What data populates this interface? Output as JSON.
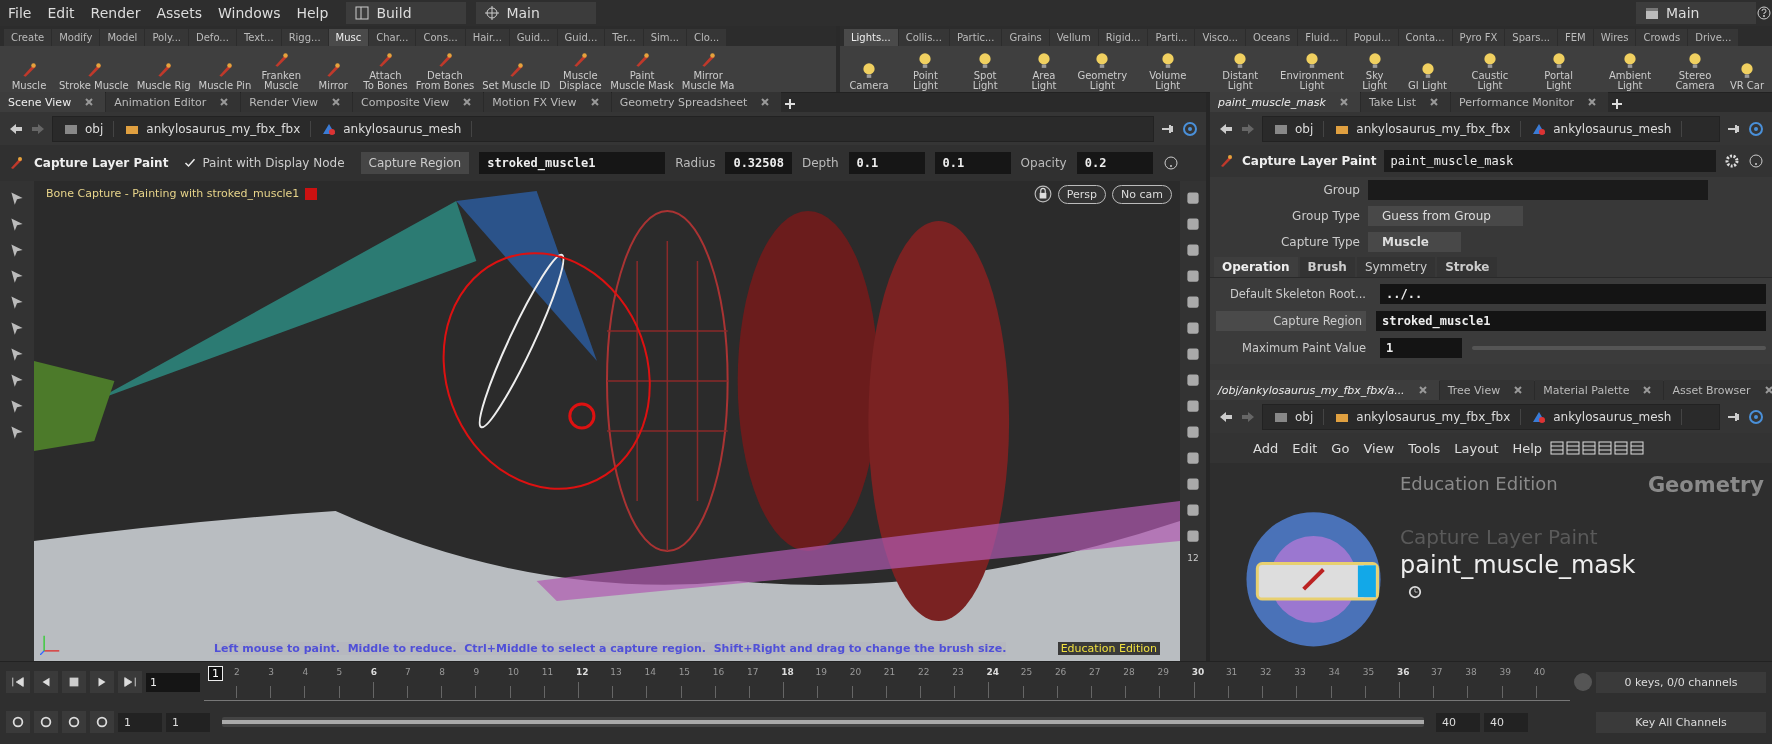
{
  "menu": [
    "File",
    "Edit",
    "Render",
    "Assets",
    "Windows",
    "Help"
  ],
  "desktop": {
    "label": "Build"
  },
  "context": {
    "label": "Main"
  },
  "right_context": {
    "label": "Main"
  },
  "shelf_left": {
    "tabs": [
      {
        "label": "Create",
        "selected": false
      },
      {
        "label": "Modify",
        "selected": false
      },
      {
        "label": "Model",
        "selected": false
      },
      {
        "label": "Poly...",
        "selected": false
      },
      {
        "label": "Defo...",
        "selected": false
      },
      {
        "label": "Text...",
        "selected": false
      },
      {
        "label": "Rigg...",
        "selected": false
      },
      {
        "label": "Musc",
        "selected": true
      },
      {
        "label": "Char...",
        "selected": false
      },
      {
        "label": "Cons...",
        "selected": false
      },
      {
        "label": "Hair...",
        "selected": false
      },
      {
        "label": "Guid...",
        "selected": false
      },
      {
        "label": "Guid...",
        "selected": false
      },
      {
        "label": "Ter...",
        "selected": false
      },
      {
        "label": "Sim...",
        "selected": false
      },
      {
        "label": "Clo...",
        "selected": false
      }
    ],
    "tools": [
      "Muscle",
      "Stroke Muscle",
      "Muscle Rig",
      "Muscle Pin",
      "Franken\nMuscle",
      "Mirror",
      "Attach\nTo Bones",
      "Detach\nFrom Bones",
      "Set Muscle ID",
      "Muscle\nDisplace",
      "Paint\nMuscle Mask",
      "Mirror\nMuscle Ma"
    ]
  },
  "shelf_right": {
    "tabs": [
      {
        "label": "Lights...",
        "selected": true
      },
      {
        "label": "Collis...",
        "selected": false
      },
      {
        "label": "Partic...",
        "selected": false
      },
      {
        "label": "Grains",
        "selected": false
      },
      {
        "label": "Vellum",
        "selected": false
      },
      {
        "label": "Rigid...",
        "selected": false
      },
      {
        "label": "Parti...",
        "selected": false
      },
      {
        "label": "Visco...",
        "selected": false
      },
      {
        "label": "Oceans",
        "selected": false
      },
      {
        "label": "Fluid...",
        "selected": false
      },
      {
        "label": "Popul...",
        "selected": false
      },
      {
        "label": "Conta...",
        "selected": false
      },
      {
        "label": "Pyro FX",
        "selected": false
      },
      {
        "label": "Spars...",
        "selected": false
      },
      {
        "label": "FEM",
        "selected": false
      },
      {
        "label": "Wires",
        "selected": false
      },
      {
        "label": "Crowds",
        "selected": false
      },
      {
        "label": "Drive...",
        "selected": false
      }
    ],
    "tools": [
      "Camera",
      "Point Light",
      "Spot Light",
      "Area Light",
      "Geometry\nLight",
      "Volume Light",
      "Distant Light",
      "Environment\nLight",
      "Sky Light",
      "GI Light",
      "Caustic Light",
      "Portal Light",
      "Ambient Light",
      "Stereo\nCamera",
      "VR Car"
    ]
  },
  "scene_pane": {
    "tabs": [
      {
        "label": "Scene View",
        "selected": true
      },
      {
        "label": "Animation Editor",
        "selected": false
      },
      {
        "label": "Render View",
        "selected": false
      },
      {
        "label": "Composite View",
        "selected": false
      },
      {
        "label": "Motion FX View",
        "selected": false
      },
      {
        "label": "Geometry Spreadsheet",
        "selected": false
      }
    ],
    "path": [
      "obj",
      "ankylosaurus_my_fbx_fbx",
      "ankylosaurus_mesh"
    ],
    "tool_options": {
      "title": "Capture Layer Paint",
      "display_node": {
        "label": "Paint with Display Node",
        "checked": true
      },
      "region_button": "Capture Region",
      "region_value": "stroked_muscle1",
      "radius_label": "Radius",
      "radius": "0.32508",
      "depth_label": "Depth",
      "depth": [
        "0.1",
        "0.1"
      ],
      "opacity_label": "Opacity",
      "opacity": "0.2"
    },
    "viewport": {
      "status": "Bone Capture - Painting with stroked_muscle1",
      "view": "Persp",
      "camera": "No cam",
      "hint": "Left mouse to paint.  Middle to reduce.  Ctrl+Middle to select a capture region.  Shift+Right and drag to change the brush size.",
      "edition": "Education Edition",
      "toolbar_number": "12"
    }
  },
  "param_pane": {
    "tabs": [
      {
        "label": "paint_muscle_mask",
        "selected": true
      },
      {
        "label": "Take List",
        "selected": false
      },
      {
        "label": "Performance Monitor",
        "selected": false
      }
    ],
    "path": [
      "obj",
      "ankylosaurus_my_fbx_fbx",
      "ankylosaurus_mesh"
    ],
    "node_type": "Capture Layer Paint",
    "node_name": "paint_muscle_mask",
    "fields": [
      {
        "label": "Group",
        "kind": "text"
      },
      {
        "label": "Group Type",
        "kind": "menu",
        "value": "Guess from Group"
      },
      {
        "label": "Capture Type",
        "kind": "menu",
        "value": "Muscle"
      }
    ],
    "subtabs": [
      {
        "label": "Operation",
        "selected": true
      },
      {
        "label": "Brush",
        "selected": false
      },
      {
        "label": "Symmetry",
        "selected": false
      },
      {
        "label": "Stroke",
        "selected": false
      }
    ],
    "rows": [
      {
        "label": "Default Skeleton Root...",
        "kind": "text",
        "value": "../.."
      },
      {
        "label": "Capture Region",
        "kind": "button-menu",
        "value": "stroked_muscle1"
      },
      {
        "label": "Maximum Paint Value",
        "kind": "slider",
        "value": "1"
      }
    ]
  },
  "network_pane": {
    "tabs": [
      {
        "label": "/obj/ankylosaurus_my_fbx_fbx/a...",
        "selected": true
      },
      {
        "label": "Tree View",
        "selected": false
      },
      {
        "label": "Material Palette",
        "selected": false
      },
      {
        "label": "Asset Browser",
        "selected": false
      }
    ],
    "path": [
      "obj",
      "ankylosaurus_my_fbx_fbx",
      "ankylosaurus_mesh"
    ],
    "menu": [
      "Add",
      "Edit",
      "Go",
      "View",
      "Tools",
      "Layout",
      "Help"
    ],
    "edition": "Education Edition",
    "context": "Geometry",
    "node": {
      "type": "Capture Layer Paint",
      "name": "paint_muscle_mask",
      "display": true
    }
  },
  "timeline": {
    "frame": "1",
    "current": "1",
    "ticks": [
      {
        "label": "2",
        "major": false
      },
      {
        "label": "3",
        "major": false
      },
      {
        "label": "4",
        "major": false
      },
      {
        "label": "5",
        "major": false
      },
      {
        "label": "6",
        "major": true
      },
      {
        "label": "7",
        "major": false
      },
      {
        "label": "8",
        "major": false
      },
      {
        "label": "9",
        "major": false
      },
      {
        "label": "10",
        "major": false
      },
      {
        "label": "11",
        "major": false
      },
      {
        "label": "12",
        "major": true
      },
      {
        "label": "13",
        "major": false
      },
      {
        "label": "14",
        "major": false
      },
      {
        "label": "15",
        "major": false
      },
      {
        "label": "16",
        "major": false
      },
      {
        "label": "17",
        "major": false
      },
      {
        "label": "18",
        "major": true
      },
      {
        "label": "19",
        "major": false
      },
      {
        "label": "20",
        "major": false
      },
      {
        "label": "21",
        "major": false
      },
      {
        "label": "22",
        "major": false
      },
      {
        "label": "23",
        "major": false
      },
      {
        "label": "24",
        "major": true
      },
      {
        "label": "25",
        "major": false
      },
      {
        "label": "26",
        "major": false
      },
      {
        "label": "27",
        "major": false
      },
      {
        "label": "28",
        "major": false
      },
      {
        "label": "29",
        "major": false
      },
      {
        "label": "30",
        "major": true
      },
      {
        "label": "31",
        "major": false
      },
      {
        "label": "32",
        "major": false
      },
      {
        "label": "33",
        "major": false
      },
      {
        "label": "34",
        "major": false
      },
      {
        "label": "35",
        "major": false
      },
      {
        "label": "36",
        "major": true
      },
      {
        "label": "37",
        "major": false
      },
      {
        "label": "38",
        "major": false
      },
      {
        "label": "39",
        "major": false
      },
      {
        "label": "40",
        "major": false
      }
    ],
    "range": [
      "1",
      "1",
      "40",
      "40"
    ],
    "range_slider": {
      "level": 1
    },
    "keys": "0 keys, 0/0 channels",
    "key_mode": "Key All Channels"
  }
}
